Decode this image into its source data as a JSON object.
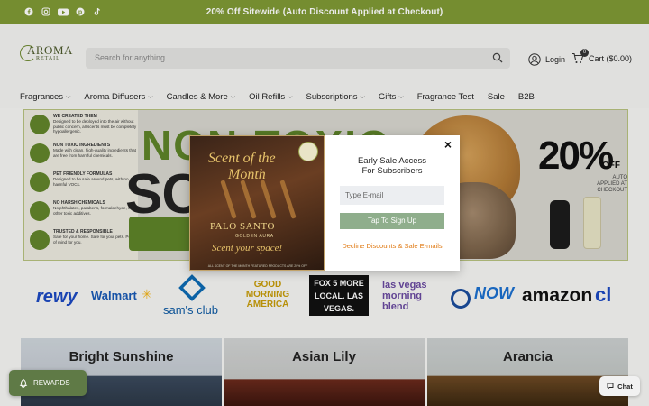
{
  "announcement": {
    "text": "20% Off Sitewide (Auto Discount Applied at Checkout)"
  },
  "social_icons": [
    "facebook-icon",
    "instagram-icon",
    "youtube-icon",
    "pinterest-icon",
    "tiktok-icon"
  ],
  "colors": {
    "brand_green": "#7f9a35",
    "signup_button": "#8fae8c",
    "decline_link": "#e07b16",
    "rewards_button": "#5f7a46"
  },
  "header": {
    "logo_text": "AROMA",
    "logo_sub": "RETAIL",
    "search_placeholder": "Search for anything",
    "login_label": "Login",
    "cart_label": "Cart ($0.00)",
    "cart_count": "0"
  },
  "nav": {
    "items": [
      {
        "label": "Fragrances",
        "dropdown": true
      },
      {
        "label": "Aroma Diffusers",
        "dropdown": true
      },
      {
        "label": "Candles & More",
        "dropdown": true
      },
      {
        "label": "Oil Refills",
        "dropdown": true
      },
      {
        "label": "Subscriptions",
        "dropdown": true
      },
      {
        "label": "Gifts",
        "dropdown": true
      },
      {
        "label": "Fragrance Test",
        "dropdown": false
      },
      {
        "label": "Sale",
        "dropdown": false
      },
      {
        "label": "B2B",
        "dropdown": false
      }
    ]
  },
  "hero": {
    "features": [
      {
        "title": "WE CREATED THEM",
        "text": "Designed to be deployed into the air without public concern, all scents must be completely hypoallergenic."
      },
      {
        "title": "NON TOXIC INGREDIENTS",
        "text": "Made with clean, high-quality ingredients that are free from harmful chemicals."
      },
      {
        "title": "PET FRIENDLY FORMULAS",
        "text": "Designed to be safe around pets, with no harmful VOCs."
      },
      {
        "title": "NO HARSH CHEMICALS",
        "text": "No phthalates, parabens, formaldehyde, or other toxic additives."
      },
      {
        "title": "TRUSTED & RESPONSIBLE",
        "text": "Safe for your home. Safe for your pets. Peace of mind for you."
      }
    ],
    "headline_1": "NON-TOXIC",
    "headline_2": "SCEN",
    "discount": "20%",
    "off": "OFF",
    "auto_applied": "AUTO APPLIED AT CHECKOUT"
  },
  "press": [
    "rewy",
    "Walmart",
    "sam's club",
    "GOOD MORNING AMERICA",
    "FOX 5 MORE LOCAL. LAS VEGAS.",
    "las vegas morning blend",
    "NOW",
    "amazon",
    "cl"
  ],
  "collections": [
    "Bright Sunshine",
    "Asian Lily",
    "Arancia"
  ],
  "modal": {
    "promo_line_1": "Scent of the",
    "promo_line_2": "Month",
    "promo_product": "PALO SANTO",
    "promo_sub": "GOLDEN AURA",
    "promo_cta": "Scent your space!",
    "promo_fine": "ALL SCENT OF THE MONTH FEATURED PRODUCTS ARE 20% OFF",
    "heading": "Early Sale Access For Subscribers",
    "email_placeholder": "Type E-mail",
    "signup_label": "Tap To Sign Up",
    "decline_label": "Decline Discounts & Sale E-mails",
    "close_label": "×"
  },
  "floating": {
    "rewards_label": "REWARDS",
    "chat_label": "Chat"
  }
}
